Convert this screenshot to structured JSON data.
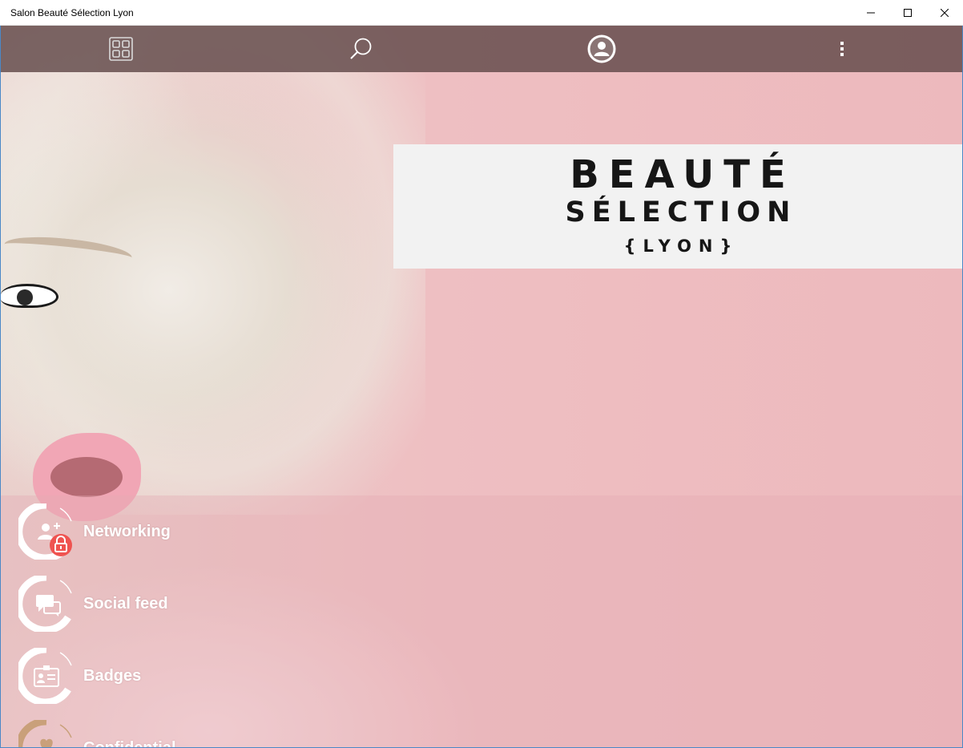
{
  "window": {
    "title": "Salon Beauté Sélection Lyon"
  },
  "appbar": {
    "icons": [
      "grid-icon",
      "search-icon",
      "profile-icon",
      "more-vertical-icon"
    ]
  },
  "logo": {
    "line1": "BEAUTÉ",
    "line2": "SÉLECTION",
    "line3": "{LYON}"
  },
  "menu": {
    "items": [
      {
        "label": "Networking",
        "icon": "networking-icon",
        "locked": true
      },
      {
        "label": "Social feed",
        "icon": "chat-bubbles-icon",
        "locked": false
      },
      {
        "label": "Badges",
        "icon": "badge-icon",
        "locked": false
      },
      {
        "label": "Confidential",
        "icon": "heart-icon",
        "locked": false
      }
    ]
  },
  "colors": {
    "appbar": "#604848",
    "background": "#ebb9bd",
    "lock_badge": "#ef5350",
    "logo_panel": "#f2f2f2",
    "confidential_ring": "#c9a07a"
  }
}
